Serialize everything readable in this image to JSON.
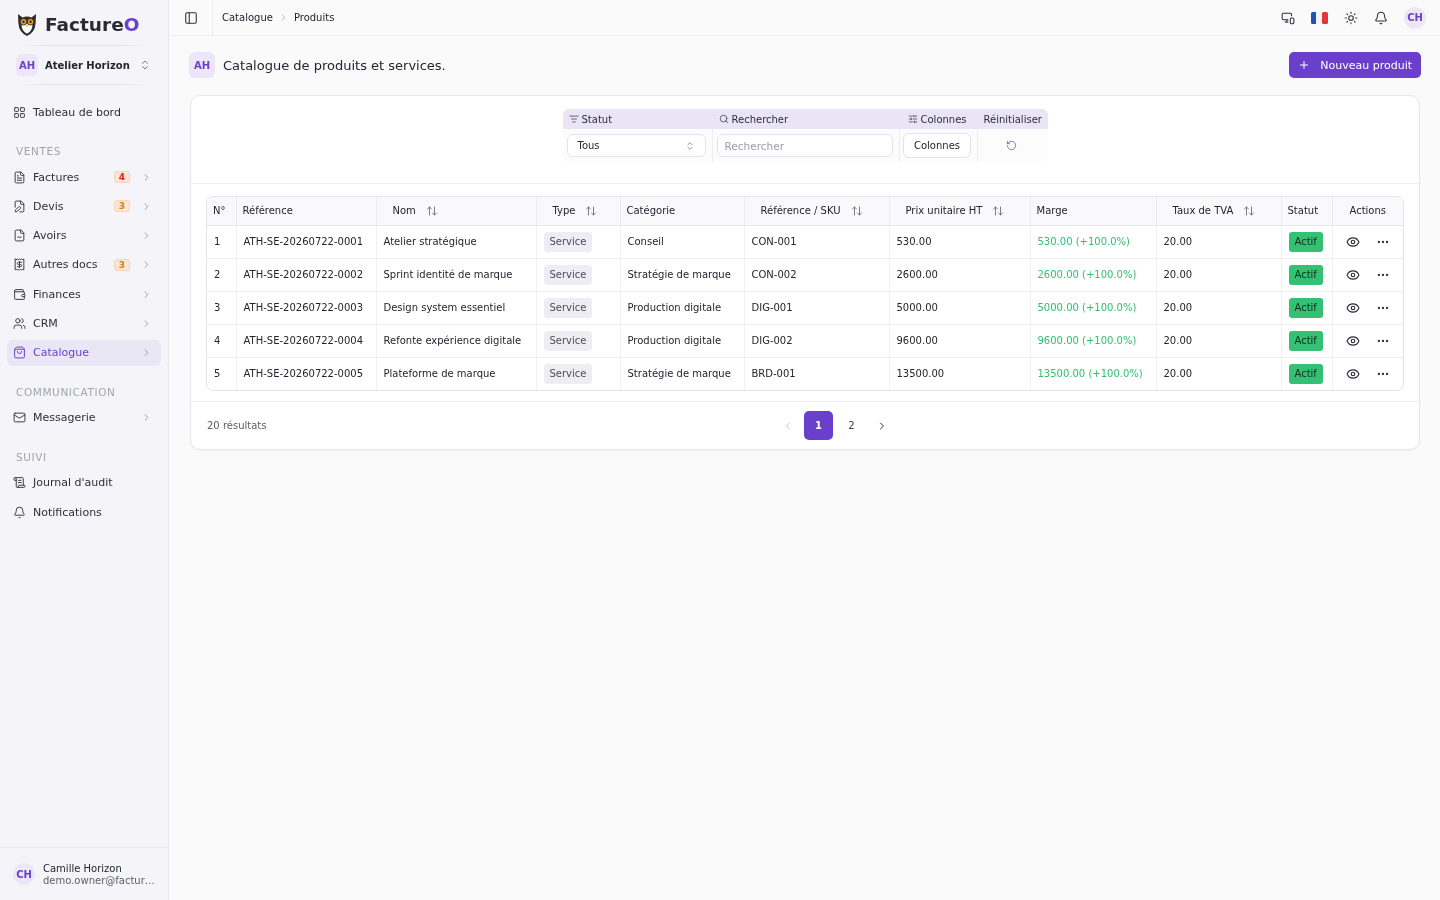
{
  "sidebar": {
    "brand": {
      "name": "Facture",
      "accent": "O"
    },
    "workspace": {
      "initials": "AH",
      "name": "Atelier Horizon"
    },
    "sections": [
      {
        "items": [
          {
            "label": "Tableau de bord",
            "expandable": false,
            "selected": false
          }
        ]
      },
      {
        "title": "VENTES",
        "items": [
          {
            "label": "Factures",
            "badge": {
              "text": "4",
              "color": "#dc2626"
            },
            "expandable": true,
            "selected": false
          },
          {
            "label": "Devis",
            "badge": {
              "text": "3",
              "color": "#d98206"
            },
            "expandable": true,
            "selected": false
          },
          {
            "label": "Avoirs",
            "expandable": true,
            "selected": false
          },
          {
            "label": "Autres docs",
            "badge": {
              "text": "3",
              "color": "#d98206"
            },
            "expandable": true,
            "selected": false
          },
          {
            "label": "Finances",
            "expandable": true,
            "selected": false
          },
          {
            "label": "CRM",
            "expandable": true,
            "selected": false
          },
          {
            "label": "Catalogue",
            "expandable": true,
            "selected": true
          }
        ]
      },
      {
        "title": "COMMUNICATION",
        "items": [
          {
            "label": "Messagerie",
            "expandable": true,
            "selected": false
          }
        ]
      },
      {
        "title": "SUIVI",
        "items": [
          {
            "label": "Journal d'audit",
            "expandable": false,
            "selected": false
          },
          {
            "label": "Notifications",
            "expandable": false,
            "selected": false
          }
        ]
      }
    ],
    "user": {
      "initials": "CH",
      "name": "Camille Horizon",
      "email": "demo.owner@factur…"
    }
  },
  "topbar": {
    "breadcrumb": [
      "Catalogue",
      "Produits"
    ],
    "avatar": "CH"
  },
  "header": {
    "initials": "AH",
    "title": "Catalogue de produits et services.",
    "primary_button": "Nouveau produit"
  },
  "filters": {
    "status": {
      "label": "Statut",
      "value": "Tous"
    },
    "search": {
      "label": "Rechercher",
      "placeholder": "Rechercher"
    },
    "columns": {
      "label": "Colonnes",
      "button": "Colonnes"
    },
    "reset": {
      "label": "Réinitialiser"
    }
  },
  "table": {
    "columns": [
      {
        "label": "N°",
        "kind": "text",
        "sortable": false
      },
      {
        "label": "Référence",
        "kind": "text",
        "sortable": false
      },
      {
        "label": "Nom",
        "kind": "text",
        "sortable": true
      },
      {
        "label": "Type",
        "kind": "tag",
        "sortable": true
      },
      {
        "label": "Catégorie",
        "kind": "text",
        "sortable": false
      },
      {
        "label": "Référence / SKU",
        "kind": "text",
        "sortable": true
      },
      {
        "label": "Prix unitaire HT",
        "kind": "text",
        "sortable": true
      },
      {
        "label": "Marge",
        "kind": "gain",
        "sortable": false
      },
      {
        "label": "Taux de TVA",
        "kind": "text",
        "sortable": true
      },
      {
        "label": "Statut",
        "kind": "status",
        "sortable": false
      },
      {
        "label": "Actions",
        "kind": "actions",
        "sortable": false
      }
    ],
    "rows": [
      {
        "cells": [
          "1",
          "ATH-SE-20260722-0001",
          "Atelier stratégique",
          "Service",
          "Conseil",
          "CON-001",
          "530.00",
          "530.00 (+100.0%)",
          "20.00",
          "Actif"
        ]
      },
      {
        "cells": [
          "2",
          "ATH-SE-20260722-0002",
          "Sprint identité de marque",
          "Service",
          "Stratégie de marque",
          "CON-002",
          "2600.00",
          "2600.00 (+100.0%)",
          "20.00",
          "Actif"
        ]
      },
      {
        "cells": [
          "3",
          "ATH-SE-20260722-0003",
          "Design system essentiel",
          "Service",
          "Production digitale",
          "DIG-001",
          "5000.00",
          "5000.00 (+100.0%)",
          "20.00",
          "Actif"
        ]
      },
      {
        "cells": [
          "4",
          "ATH-SE-20260722-0004",
          "Refonte expérience digitale",
          "Service",
          "Production digitale",
          "DIG-002",
          "9600.00",
          "9600.00 (+100.0%)",
          "20.00",
          "Actif"
        ]
      },
      {
        "cells": [
          "5",
          "ATH-SE-20260722-0005",
          "Plateforme de marque",
          "Service",
          "Stratégie de marque",
          "BRD-001",
          "13500.00",
          "13500.00 (+100.0%)",
          "20.00",
          "Actif"
        ]
      }
    ]
  },
  "pagination": {
    "summary": "20 résultats",
    "previous_disabled": true,
    "next_disabled": false,
    "pages": [
      {
        "label": "1",
        "selected": true
      },
      {
        "label": "2",
        "selected": false
      }
    ]
  }
}
